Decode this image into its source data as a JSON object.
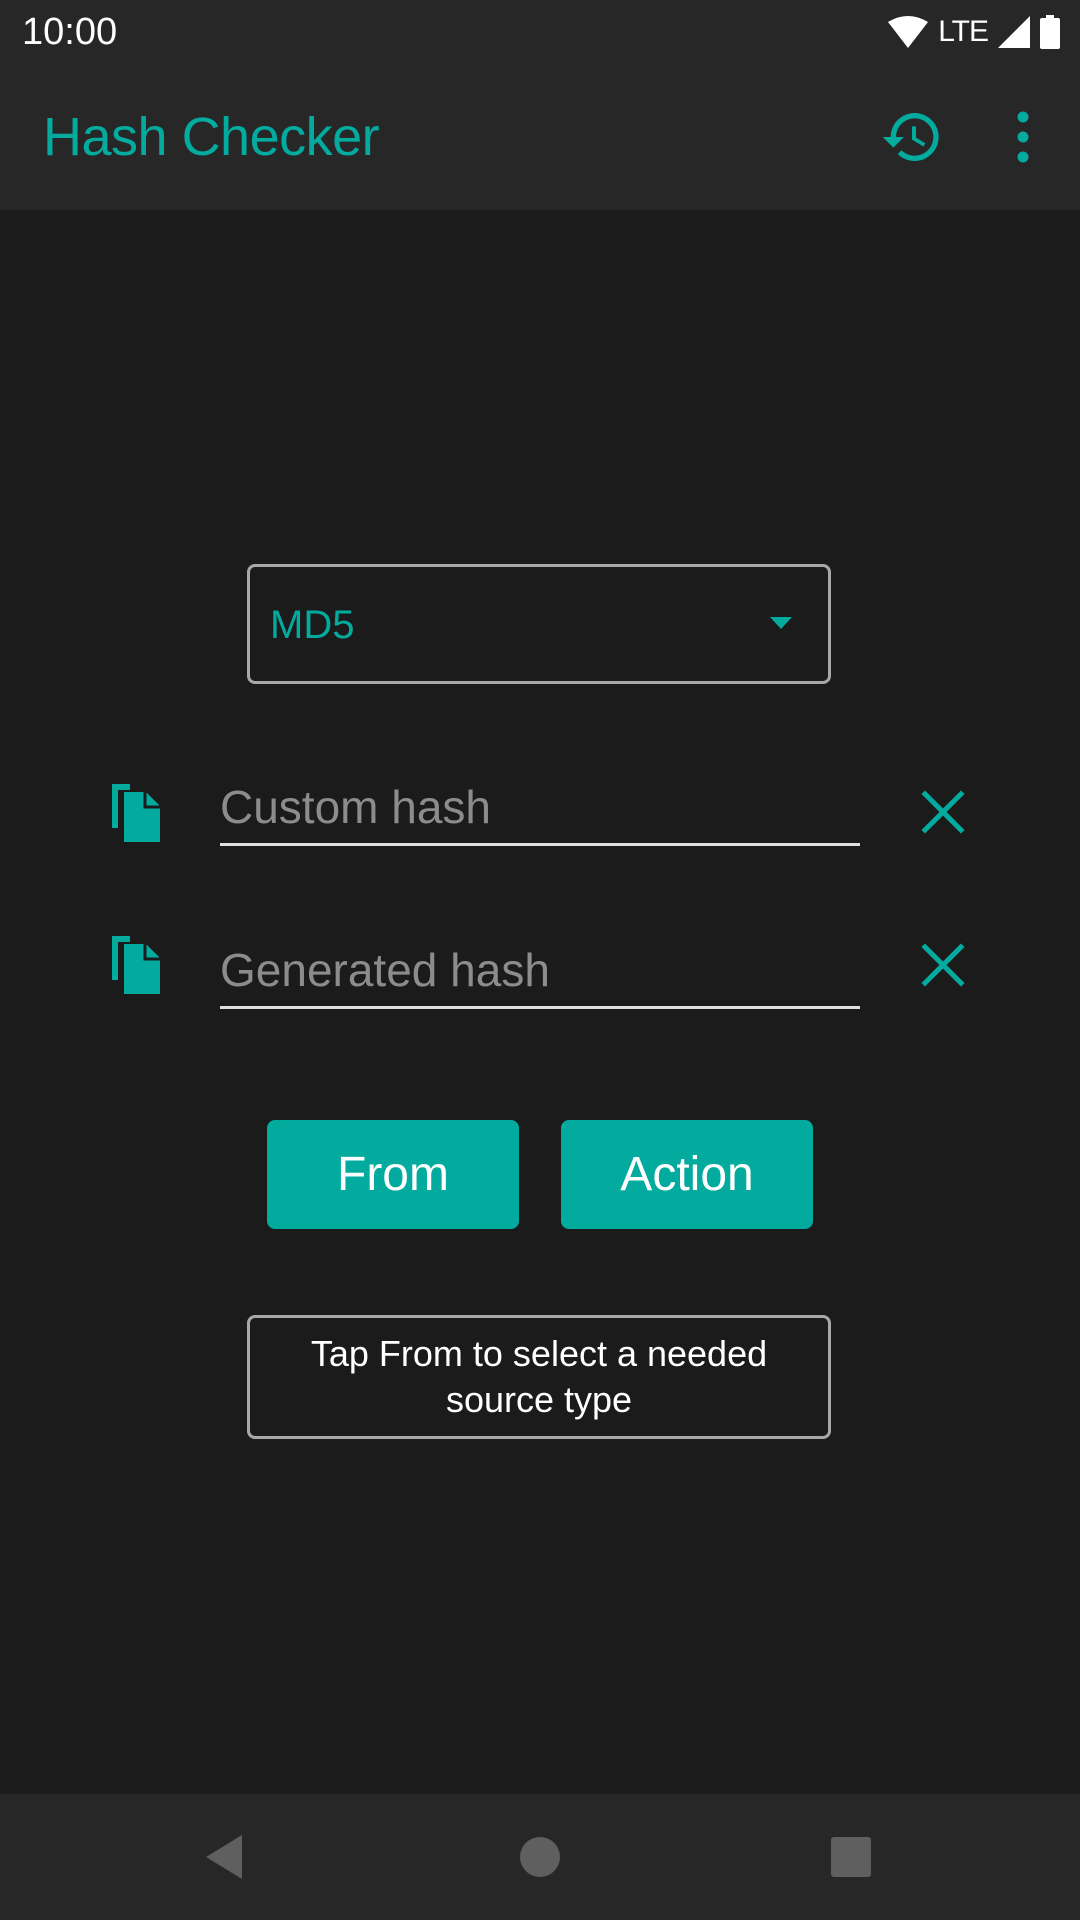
{
  "status_bar": {
    "time": "10:00",
    "network": "LTE",
    "icons": [
      "wifi-icon",
      "cell-signal-icon",
      "battery-icon"
    ]
  },
  "app_bar": {
    "title": "Hash Checker",
    "actions": [
      "history-icon",
      "more-vert-icon"
    ]
  },
  "hash_type": {
    "selected": "MD5"
  },
  "custom_hash": {
    "placeholder": "Custom hash",
    "value": ""
  },
  "generated_hash": {
    "placeholder": "Generated hash",
    "value": ""
  },
  "buttons": {
    "from_label": "From",
    "action_label": "Action"
  },
  "info": {
    "text": "Tap From to select a needed source type"
  },
  "navigation": {
    "items": [
      "back-icon",
      "home-icon",
      "recents-icon"
    ]
  },
  "colors": {
    "accent": "#03ab9f",
    "background": "#1b1b1b",
    "bars": "#272727"
  }
}
